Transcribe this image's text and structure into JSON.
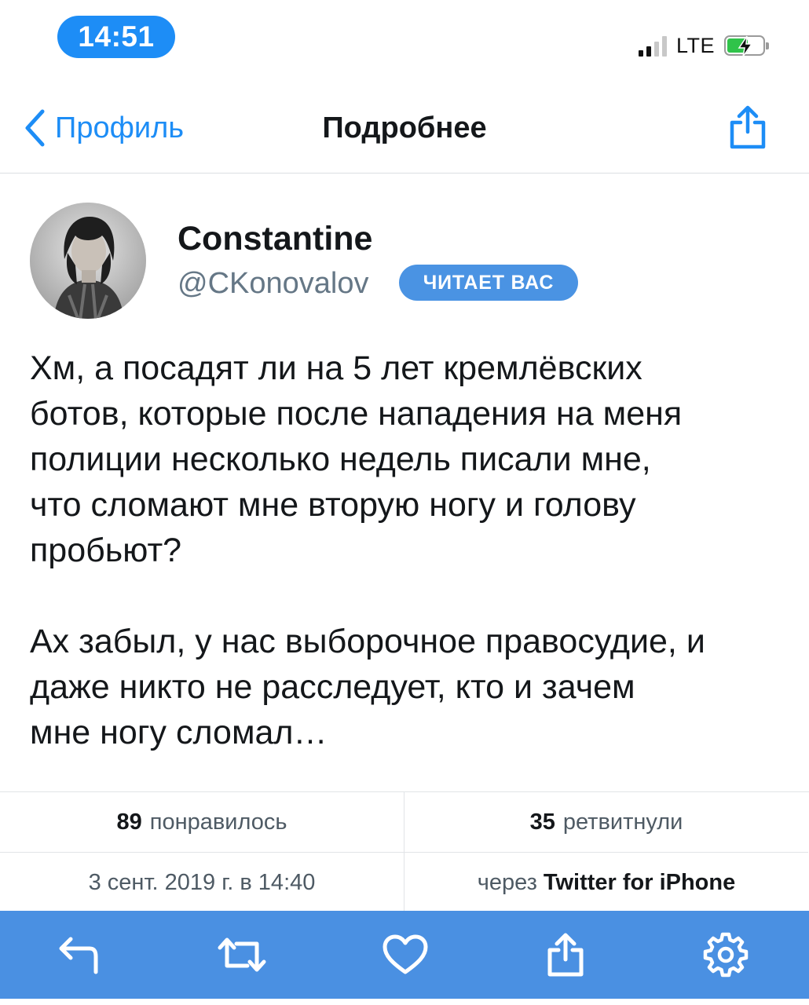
{
  "status_bar": {
    "time": "14:51",
    "network": "LTE"
  },
  "nav": {
    "back_label": "Профиль",
    "title": "Подробнее"
  },
  "author": {
    "name": "Constantine",
    "handle": "@CKonovalov",
    "follows_you_badge": "ЧИТАЕТ ВАС"
  },
  "tweet": {
    "paragraph1": "Хм, а посадят ли на 5 лет кремлёвских\nботов, которые после нападения на меня\nполиции несколько недель писали мне,\nчто сломают мне вторую ногу и голову\nпробьют?",
    "paragraph2": "Ах забыл, у нас выборочное правосудие, и\nдаже никто не расследует, кто и зачем\nмне ногу сломал…"
  },
  "stats": {
    "likes_count": "89",
    "likes_label": "понравилось",
    "retweets_count": "35",
    "retweets_label": "ретвитнули",
    "timestamp": "3 сент. 2019 г. в 14:40",
    "via_prefix": "через",
    "via_client": "Twitter for iPhone"
  },
  "icons": {
    "back": "chevron-left-icon",
    "share": "share-icon",
    "reply": "reply-icon",
    "retweet": "retweet-icon",
    "like": "heart-icon",
    "settings": "gear-icon"
  },
  "colors": {
    "accent": "#1d8df6",
    "toolbar": "#4a90e2",
    "badge": "#4a93e3",
    "muted_text": "#657786",
    "battery_fill": "#30c34a"
  }
}
